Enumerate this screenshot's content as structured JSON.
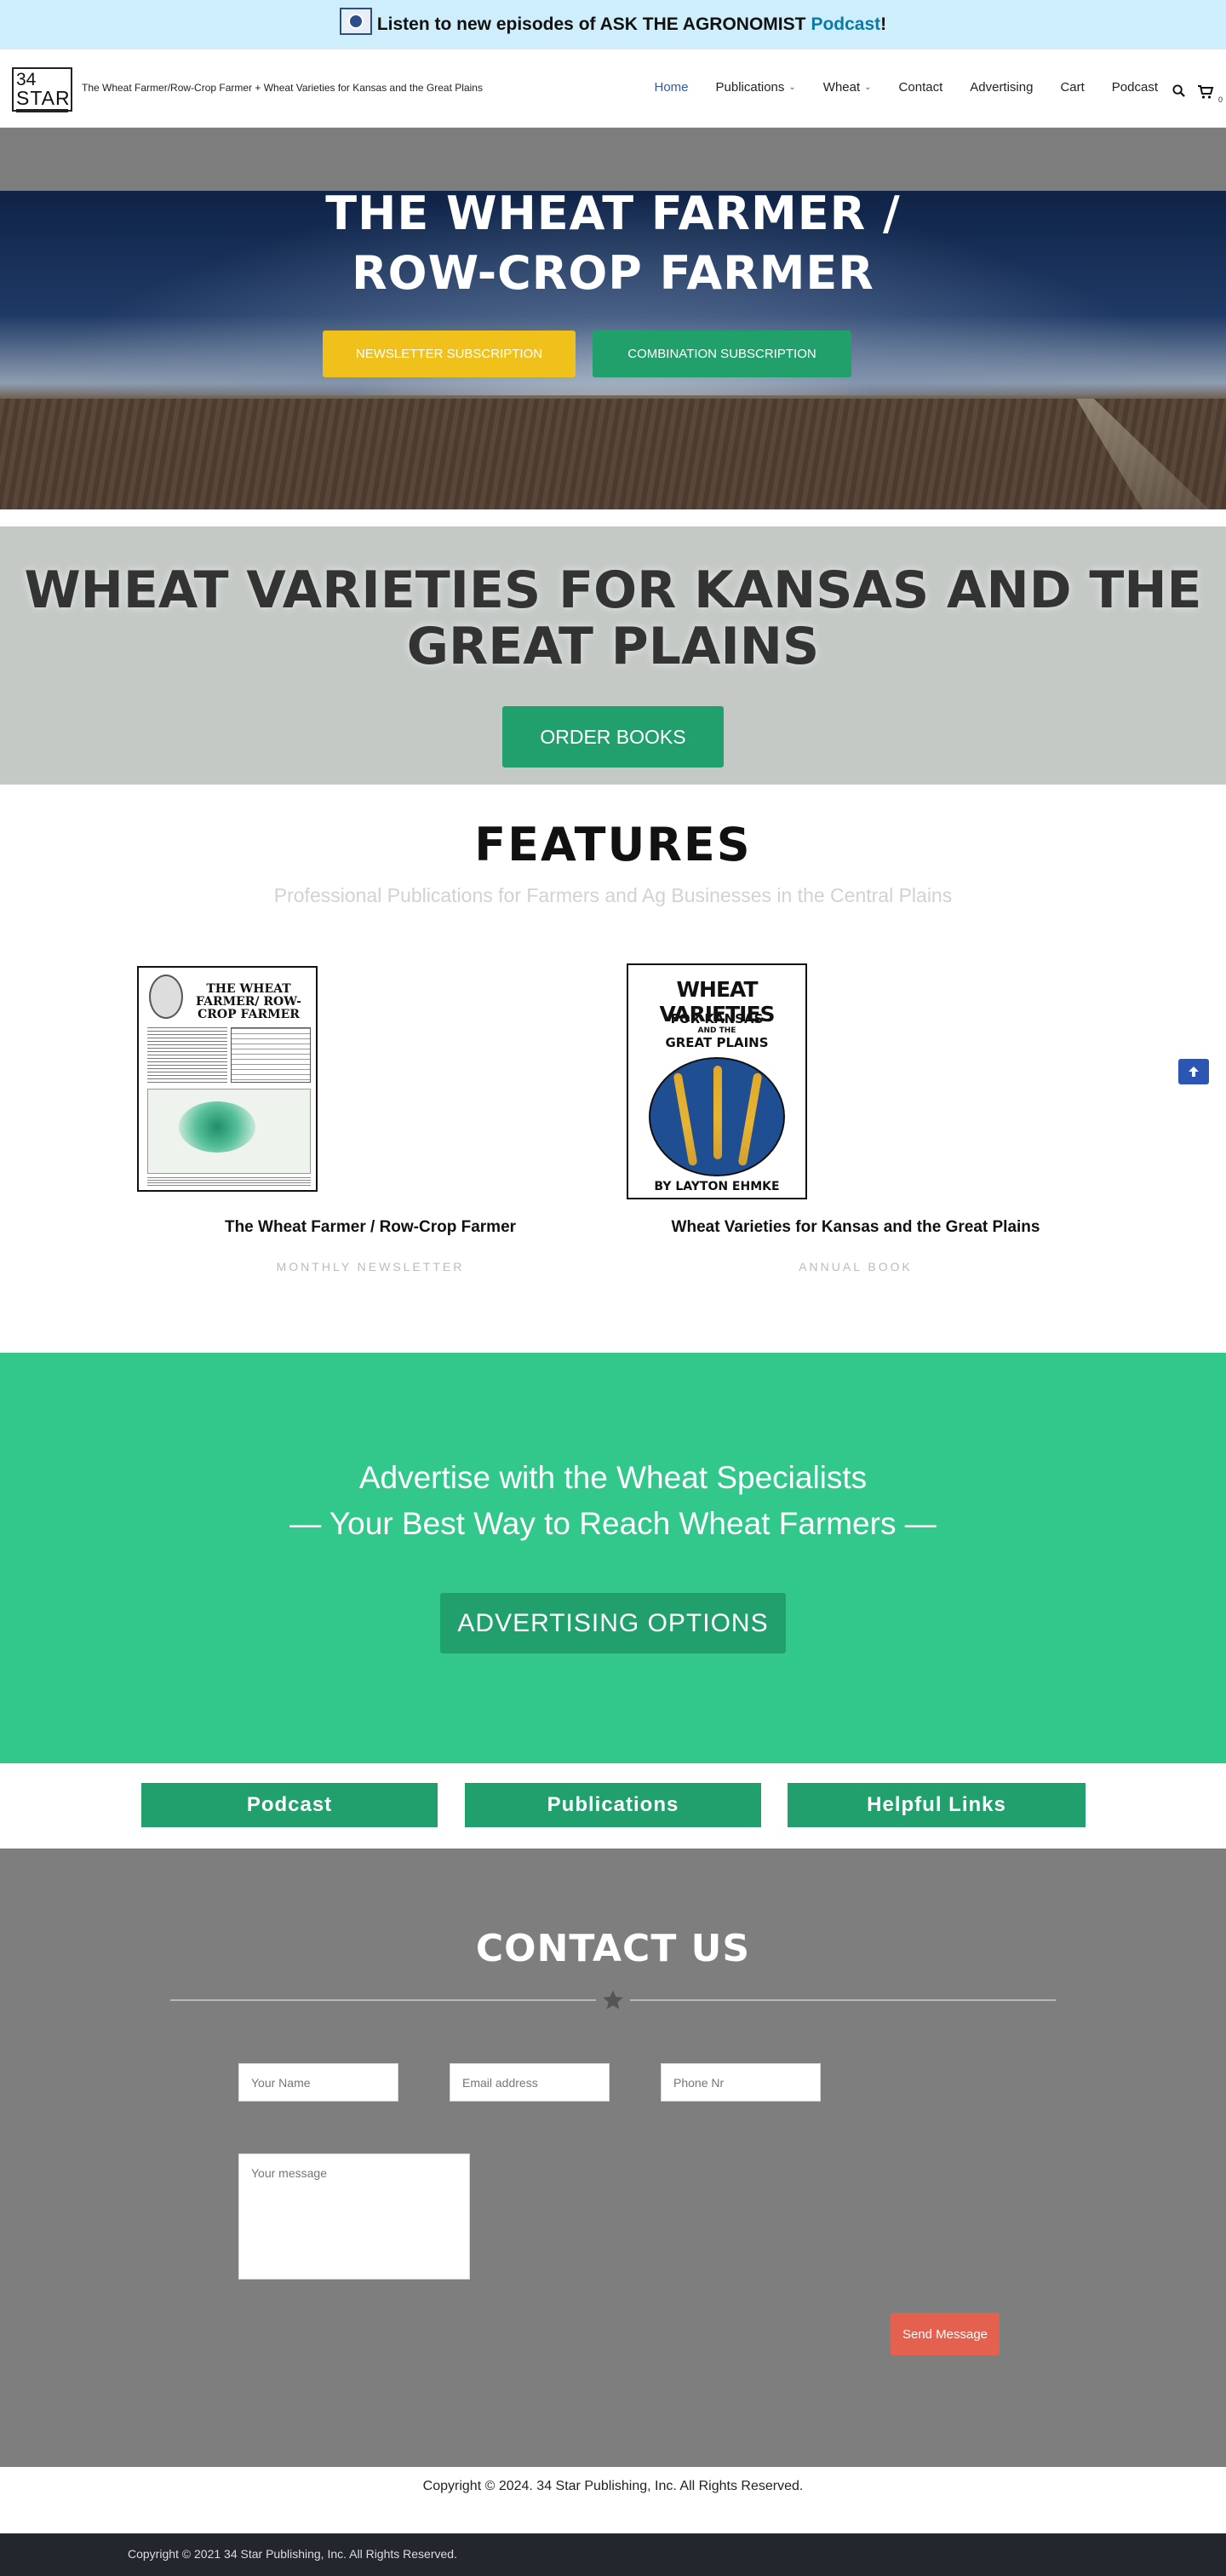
{
  "banner": {
    "text": "Listen to new episodes of ASK THE AGRONOMIST",
    "link": "Podcast",
    "suffix": "!"
  },
  "header": {
    "logo_number": "34",
    "logo_word": "STAR",
    "tagline": "The Wheat Farmer/Row-Crop Farmer + Wheat Varieties for Kansas and the Great Plains",
    "nav": [
      {
        "label": "Home",
        "active": true
      },
      {
        "label": "Publications",
        "dropdown": true
      },
      {
        "label": "Wheat",
        "dropdown": true
      },
      {
        "label": "Contact"
      },
      {
        "label": "Advertising"
      },
      {
        "label": "Cart"
      },
      {
        "label": "Podcast"
      }
    ],
    "cart_count": "0",
    "icons": {
      "search": "search-icon",
      "cart": "cart-icon"
    }
  },
  "hero": {
    "title_line1": "THE WHEAT FARMER /",
    "title_line2": "ROW-CROP FARMER",
    "btn_newsletter": "NEWSLETTER SUBSCRIPTION",
    "btn_combo": "COMBINATION SUBSCRIPTION"
  },
  "wheat_varieties": {
    "title_line1": "WHEAT VARIETIES FOR KANSAS AND THE",
    "title_line2": "GREAT PLAINS",
    "btn_order": "ORDER BOOKS"
  },
  "features": {
    "title": "FEATURES",
    "subtitle": "Professional Publications for Farmers and Ag Businesses in the Central Plains",
    "items": [
      {
        "title": "The Wheat Farmer / Row-Crop Farmer",
        "subtitle": "MONTHLY NEWSLETTER",
        "cover_heading": "THE WHEAT FARMER/ ROW-CROP FARMER"
      },
      {
        "title": "Wheat Varieties for Kansas and the Great Plains",
        "subtitle": "ANNUAL BOOK",
        "cover_heading": "WHEAT VARIETIES",
        "cover_sub1": "FOR KANSAS",
        "cover_sub2": "AND THE",
        "cover_sub3": "GREAT PLAINS",
        "cover_author": "BY LAYTON EHMKE"
      }
    ]
  },
  "advertise": {
    "line1": "Advertise with the Wheat Specialists",
    "line2": "— Your Best Way to Reach Wheat Farmers —",
    "button": "ADVERTISING OPTIONS"
  },
  "quick_links": [
    "Podcast",
    "Publications",
    "Helpful Links"
  ],
  "contact": {
    "title": "CONTACT US",
    "name_placeholder": "Your Name",
    "email_placeholder": "Email address",
    "phone_placeholder": "Phone Nr",
    "message_placeholder": "Your message",
    "send_label": "Send Message"
  },
  "footer": {
    "copyright": "Copyright © 2024. 34 Star Publishing, Inc. All Rights Reserved.",
    "bottom_copyright": "Copyright © 2021 34 Star Publishing, Inc. All Rights Reserved."
  },
  "colors": {
    "banner_bg": "#cdeefa",
    "accent_green": "#21a06e",
    "advert_green": "#32c88b",
    "newsletter_yellow": "#f0c01b",
    "send_red": "#e4604f",
    "nav_active": "#2f5aa8"
  }
}
